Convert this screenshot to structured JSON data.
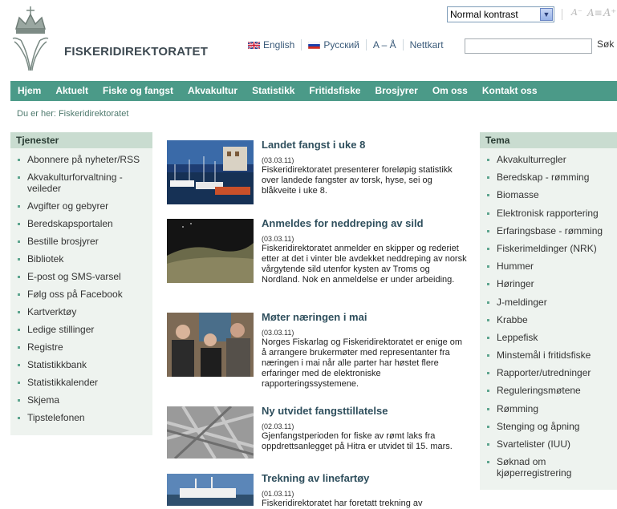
{
  "header": {
    "logo_text": "FISKERIDIREKTORATET",
    "contrast_select": "Normal kontrast",
    "font_controls": [
      "A⁻",
      "A≡",
      "A⁺"
    ],
    "links": [
      "English",
      "Русский",
      "A – Å",
      "Nettkart"
    ],
    "search_button": "Søk"
  },
  "nav": [
    "Hjem",
    "Aktuelt",
    "Fiske og fangst",
    "Akvakultur",
    "Statistikk",
    "Fritidsfiske",
    "Brosjyrer",
    "Om oss",
    "Kontakt oss"
  ],
  "breadcrumb": "Du er her: Fiskeridirektoratet",
  "tjenester": {
    "title": "Tjenester",
    "items": [
      "Abonnere på nyheter/RSS",
      "Akvakulturforvaltning -",
      "veileder",
      "Avgifter og gebyrer",
      "Beredskapsportalen",
      "Bestille brosjyrer",
      "Bibliotek",
      "E-post og SMS-varsel",
      "Følg oss på Facebook",
      "Kartverktøy",
      "Ledige stillinger",
      "Registre",
      "Statistikkbank",
      "Statistikkalender",
      "Skjema",
      "Tipstelefonen"
    ]
  },
  "tema": {
    "title": "Tema",
    "items": [
      "Akvakulturregler",
      "Beredskap - rømming",
      "Biomasse",
      "Elektronisk rapportering",
      "Erfaringsbase - rømming",
      "Fiskerimeldinger (NRK)",
      "Hummer",
      "Høringer",
      "J-meldinger",
      "Krabbe",
      "Leppefisk",
      "Minstemål i fritidsfiske",
      "Rapporter/utredninger",
      "Reguleringsmøtene",
      "Rømming",
      "Stenging og åpning",
      "Svartelister (IUU)",
      "Søknad om",
      "kjøperregistrering"
    ]
  },
  "news": [
    {
      "title": "Landet fangst i uke 8",
      "date": "(03.03.11)",
      "body": "Fiskeridirektoratet presenterer foreløpig statistikk over landede fangster av torsk, hyse, sei og blåkveite i uke 8."
    },
    {
      "title": "Anmeldes for neddreping av sild",
      "date": "(03.03.11)",
      "body": "Fiskeridirektoratet anmelder en skipper og rederiet etter at det i vinter ble avdekket neddreping av norsk vårgytende sild utenfor kysten av Troms og Nordland. Nok en anmeldelse er under arbeiding."
    },
    {
      "title": "Møter næringen i mai",
      "date": "(03.03.11)",
      "body": "Norges Fiskarlag og Fiskeridirektoratet er enige om å arrangere brukermøter med representanter fra næringen i mai når alle parter har høstet flere erfaringer med de elektroniske rapporteringssystemene."
    },
    {
      "title": "Ny utvidet fangsttillatelse",
      "date": "(02.03.11)",
      "body": "Gjenfangstperioden for fiske av rømt laks fra oppdrettsanlegget på Hitra er utvidet til 15. mars."
    },
    {
      "title": "Trekning av linefartøy",
      "date": "(01.03.11)",
      "body": "Fiskeridirektoratet har foretatt trekning av"
    }
  ],
  "colors": {
    "nav_bg": "#4b9a88",
    "side_header_bg": "#c9dcd0",
    "side_bg": "#eef3ef"
  }
}
